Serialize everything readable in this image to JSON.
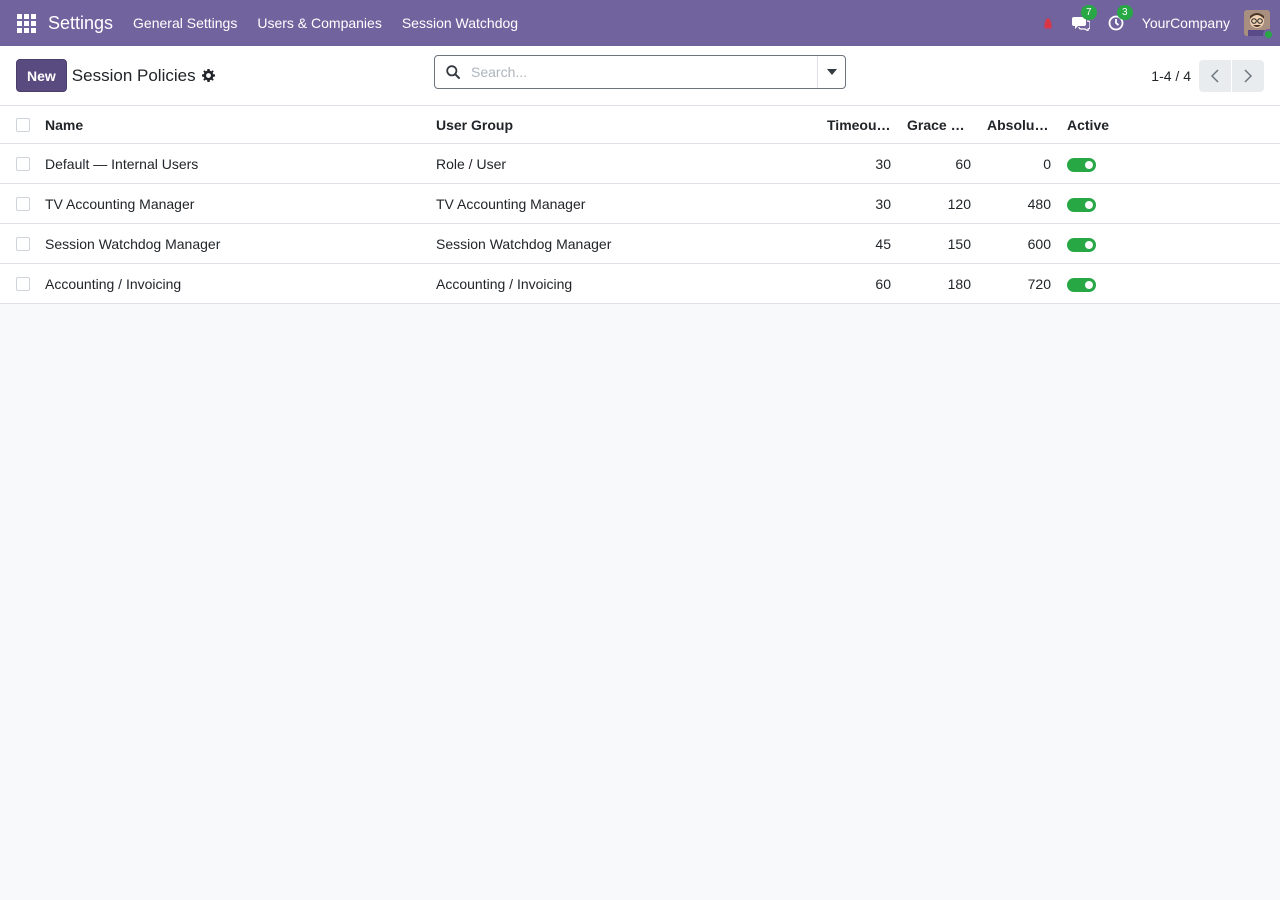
{
  "navbar": {
    "app_name": "Settings",
    "menu": [
      "General Settings",
      "Users & Companies",
      "Session Watchdog"
    ],
    "messages_count": "7",
    "activities_count": "3",
    "company": "YourCompany"
  },
  "control": {
    "new_label": "New",
    "breadcrumb": "Session Policies",
    "search_placeholder": "Search...",
    "pager_value": "1-4 / 4"
  },
  "list": {
    "headers": {
      "name": "Name",
      "group": "User Group",
      "timeout": "Timeout ...",
      "grace": "Grace S...",
      "absolute": "Absolute...",
      "active": "Active"
    },
    "rows": [
      {
        "name": "Default — Internal Users",
        "group": "Role / User",
        "timeout": "30",
        "grace": "60",
        "absolute": "0",
        "active": true
      },
      {
        "name": "TV Accounting Manager",
        "group": "TV Accounting Manager",
        "timeout": "30",
        "grace": "120",
        "absolute": "480",
        "active": true
      },
      {
        "name": "Session Watchdog Manager",
        "group": "Session Watchdog Manager",
        "timeout": "45",
        "grace": "150",
        "absolute": "600",
        "active": true
      },
      {
        "name": "Accounting / Invoicing",
        "group": "Accounting / Invoicing",
        "timeout": "60",
        "grace": "180",
        "absolute": "720",
        "active": true
      }
    ]
  },
  "colors": {
    "navbar": "#71639e",
    "primary_button": "#594b7f",
    "toggle_on": "#28a745",
    "badge": "#28a745",
    "alert_icon": "#dc3545"
  }
}
